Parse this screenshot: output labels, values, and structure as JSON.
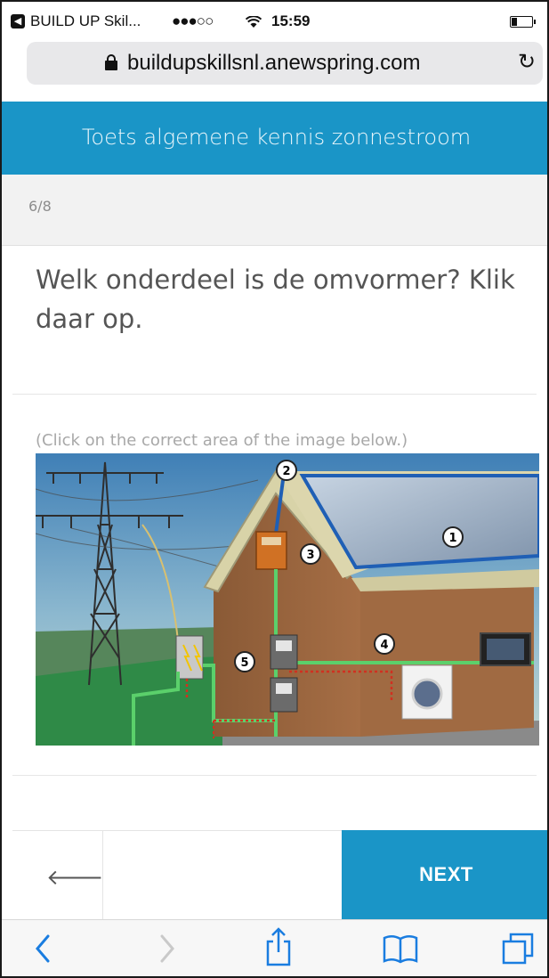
{
  "status_bar": {
    "back_app_label": "BUILD UP Skil...",
    "signal": "●●●○○",
    "time": "15:59"
  },
  "browser": {
    "url": "buildupskillsnl.anewspring.com"
  },
  "header": {
    "title": "Toets algemene kennis zonnestroom"
  },
  "quiz": {
    "progress": "6/8",
    "question": "Welk onderdeel is de omvormer? Klik daar op.",
    "instruction": "(Click on the correct area of the image below.)",
    "image_labels": [
      "1",
      "2",
      "3",
      "4",
      "5"
    ]
  },
  "nav": {
    "next_label": "NEXT"
  },
  "colors": {
    "accent": "#1a95c7",
    "progress_band": "#f2f2f2",
    "question_text": "#555555"
  },
  "icons": {
    "back": "arrow-left-icon",
    "lock": "lock-icon",
    "reload": "reload-icon",
    "safari_back": "chevron-left-icon",
    "safari_forward": "chevron-right-icon",
    "share": "share-icon",
    "bookmarks": "book-icon",
    "tabs": "tabs-icon"
  }
}
